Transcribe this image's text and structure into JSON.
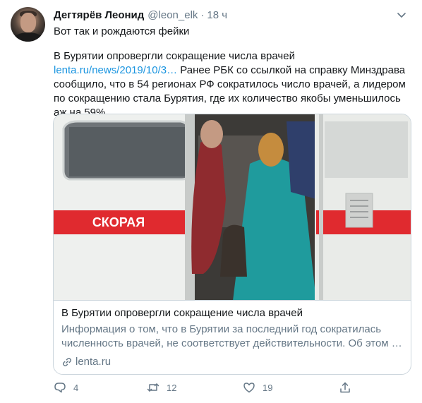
{
  "tweet": {
    "author_name": "Дегтярёв Леонид",
    "handle": "@leon_elk",
    "separator": "·",
    "time": "18 ч",
    "text": "Вот так и рождаются фейки",
    "body_line1_a": "В Бурятии опровергли сокращение числа врачей ",
    "body_link": "lenta.ru/news/2019/10/3…",
    "body_line1_b": " Ранее РБК со ссылкой на справку Минздрава сообщило, что в 54 регионах РФ сократилось число врачей, а лидером по сокращению стала Бурятия, где их количество якобы уменьшилось аж на 59%"
  },
  "card": {
    "image_caption": "СКОРАЯ",
    "title": "В Бурятии опровергли сокращение числа врачей",
    "description": "Информация о том, что в Бурятии за последний год сократилась численность врачей, не соответствует действительности. Об этом …",
    "domain": "lenta.ru"
  },
  "actions": {
    "reply_count": "4",
    "retweet_count": "12",
    "like_count": "19"
  },
  "colors": {
    "link": "#1b95e0",
    "muted": "#657786",
    "text": "#14171a",
    "border": "#ccd6dd",
    "ambulance_stripe": "#e02a2f"
  }
}
